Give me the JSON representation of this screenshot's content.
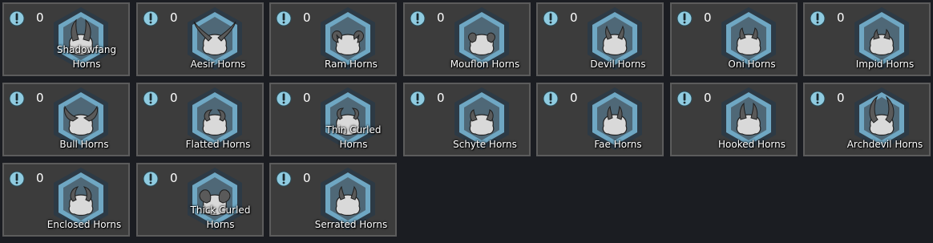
{
  "colors": {
    "background": "#1b1d22",
    "cell_bg": "#3c3c3c",
    "cell_border": "#5c5c5c",
    "hex_outer": "#2d3a45",
    "hex_ring": "#6fa7c3",
    "hex_inner": "#4f6877",
    "head": "#d9d9d9",
    "horn": "#5a5a5a",
    "count_icon": "#8fcbe0",
    "text": "#ffffff"
  },
  "items": [
    {
      "name": "Shadowfang Horns",
      "count": "0",
      "horn": "shadowfang-horn-icon"
    },
    {
      "name": "Aesir Horns",
      "count": "0",
      "horn": "aesir-horn-icon"
    },
    {
      "name": "Ram Horns",
      "count": "0",
      "horn": "ram-horn-icon"
    },
    {
      "name": "Mouflon Horns",
      "count": "0",
      "horn": "mouflon-horn-icon"
    },
    {
      "name": "Devil Horns",
      "count": "0",
      "horn": "devil-horn-icon"
    },
    {
      "name": "Oni Horns",
      "count": "0",
      "horn": "oni-horn-icon"
    },
    {
      "name": "Impid Horns",
      "count": "0",
      "horn": "impid-horn-icon"
    },
    {
      "name": "Bull Horns",
      "count": "0",
      "horn": "bull-horn-icon"
    },
    {
      "name": "Flatted Horns",
      "count": "0",
      "horn": "flatted-horn-icon"
    },
    {
      "name": "Thin Curled Horns",
      "count": "0",
      "horn": "thin-curled-horn-icon"
    },
    {
      "name": "Schyte Horns",
      "count": "0",
      "horn": "schyte-horn-icon"
    },
    {
      "name": "Fae Horns",
      "count": "0",
      "horn": "fae-horn-icon"
    },
    {
      "name": "Hooked Horns",
      "count": "0",
      "horn": "hooked-horn-icon"
    },
    {
      "name": "Archdevil Horns",
      "count": "0",
      "horn": "archdevil-horn-icon"
    },
    {
      "name": "Enclosed Horns",
      "count": "0",
      "horn": "enclosed-horn-icon"
    },
    {
      "name": "Thick Curled Horns",
      "count": "0",
      "horn": "thick-curled-horn-icon"
    },
    {
      "name": "Serrated Horns",
      "count": "0",
      "horn": "serrated-horn-icon"
    }
  ]
}
